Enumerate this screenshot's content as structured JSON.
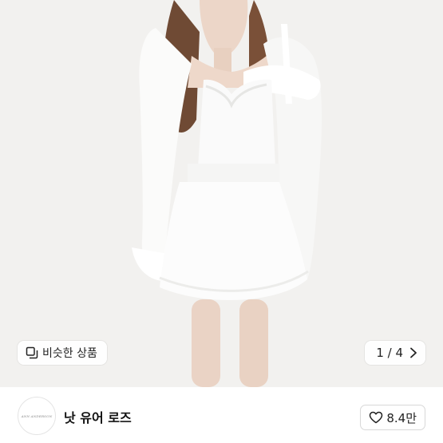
{
  "product_image": {
    "alt_icon": "product-photo"
  },
  "similar_products": {
    "icon": "stack-squares-icon",
    "label": "비슷한 상품"
  },
  "pager": {
    "text": "1 / 4",
    "next_icon": "chevron-right-icon"
  },
  "shop": {
    "logo_text": "ANN ANDERSON",
    "name": "낫 유어 로즈"
  },
  "likes": {
    "icon": "heart-outline-icon",
    "count": "8.4만"
  }
}
